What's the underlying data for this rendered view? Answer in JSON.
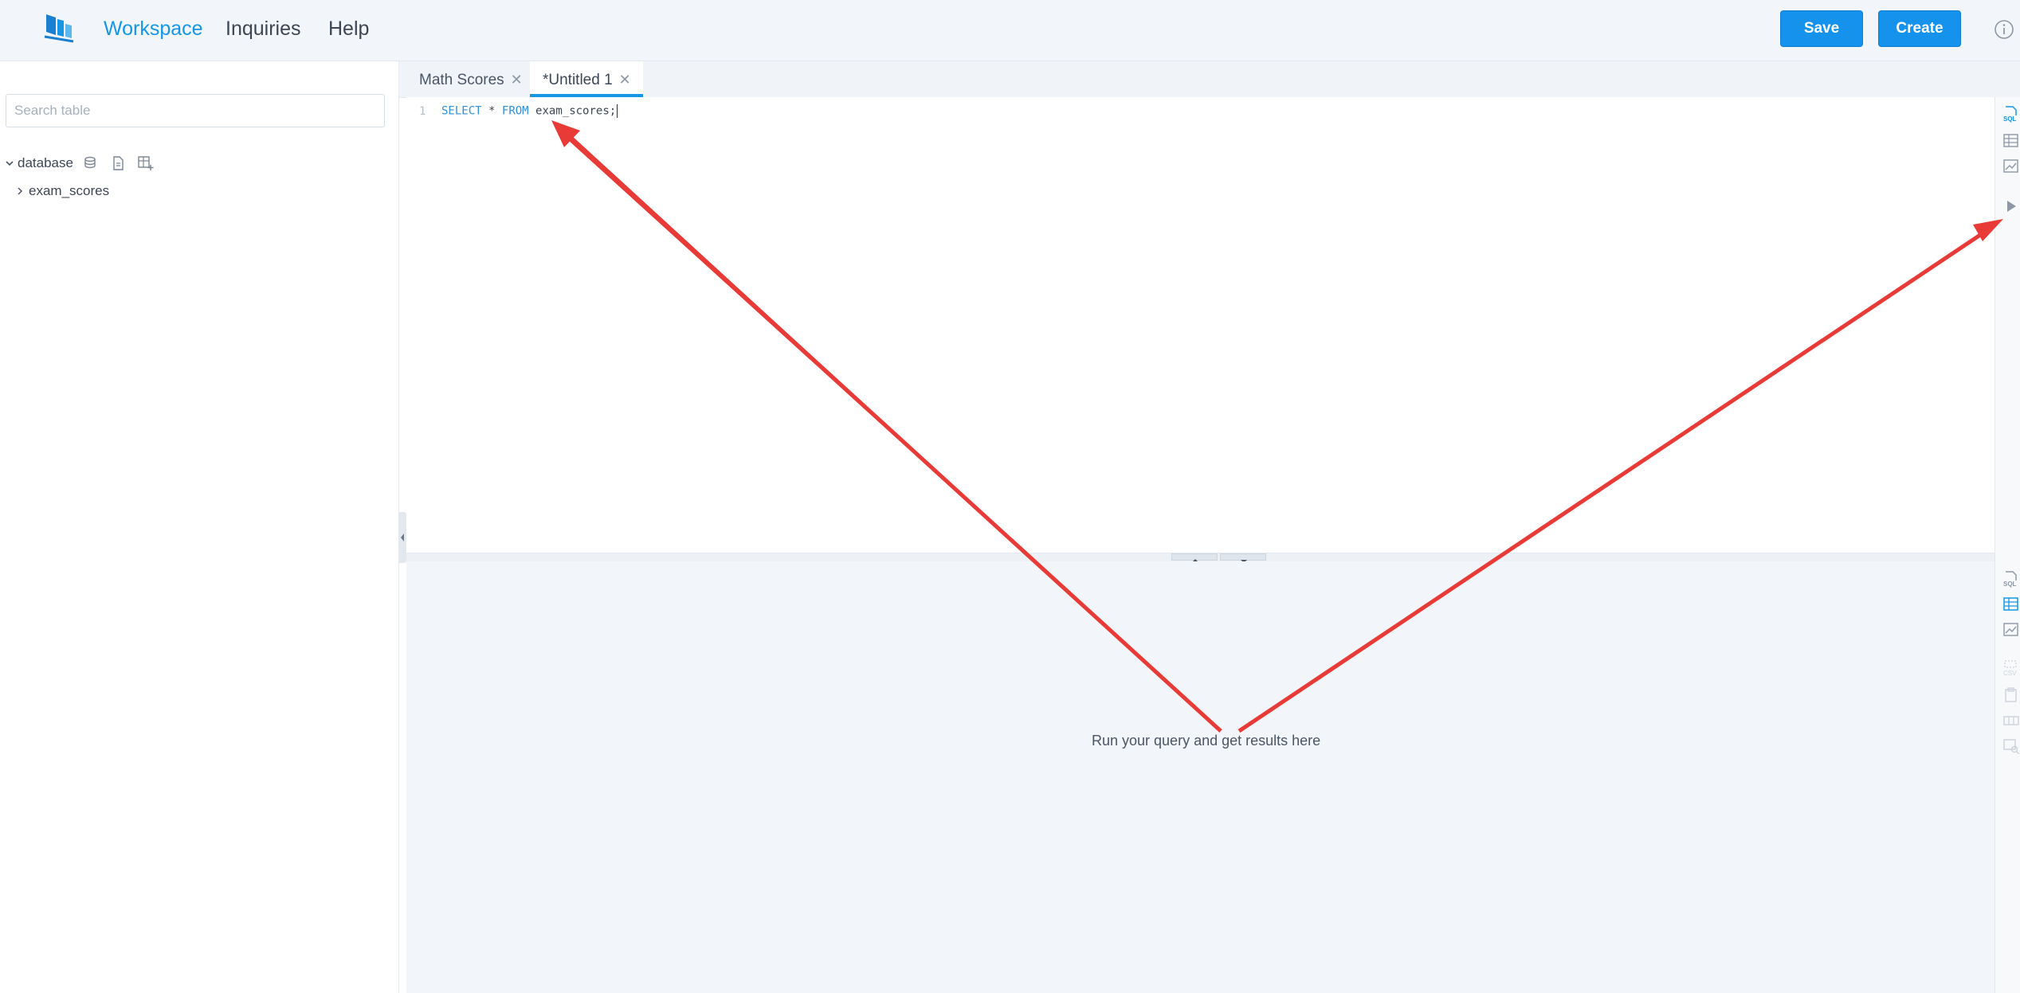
{
  "header": {
    "nav": [
      "Workspace",
      "Inquiries",
      "Help"
    ],
    "active_nav": "Workspace",
    "save_label": "Save",
    "create_label": "Create"
  },
  "sidebar": {
    "search_placeholder": "Search table",
    "root_label": "database",
    "tables": [
      "exam_scores"
    ]
  },
  "tabs": [
    {
      "label": "Math Scores",
      "active": false
    },
    {
      "label": "*Untitled 1",
      "active": true
    }
  ],
  "editor": {
    "line_number": "1",
    "keyword_select": "SELECT",
    "star": "*",
    "keyword_from": "FROM",
    "table_ref": "exam_scores;"
  },
  "results": {
    "empty_message": "Run your query and get results here"
  },
  "colors": {
    "accent": "#1597e5",
    "annotation_arrow": "#e83a36"
  }
}
